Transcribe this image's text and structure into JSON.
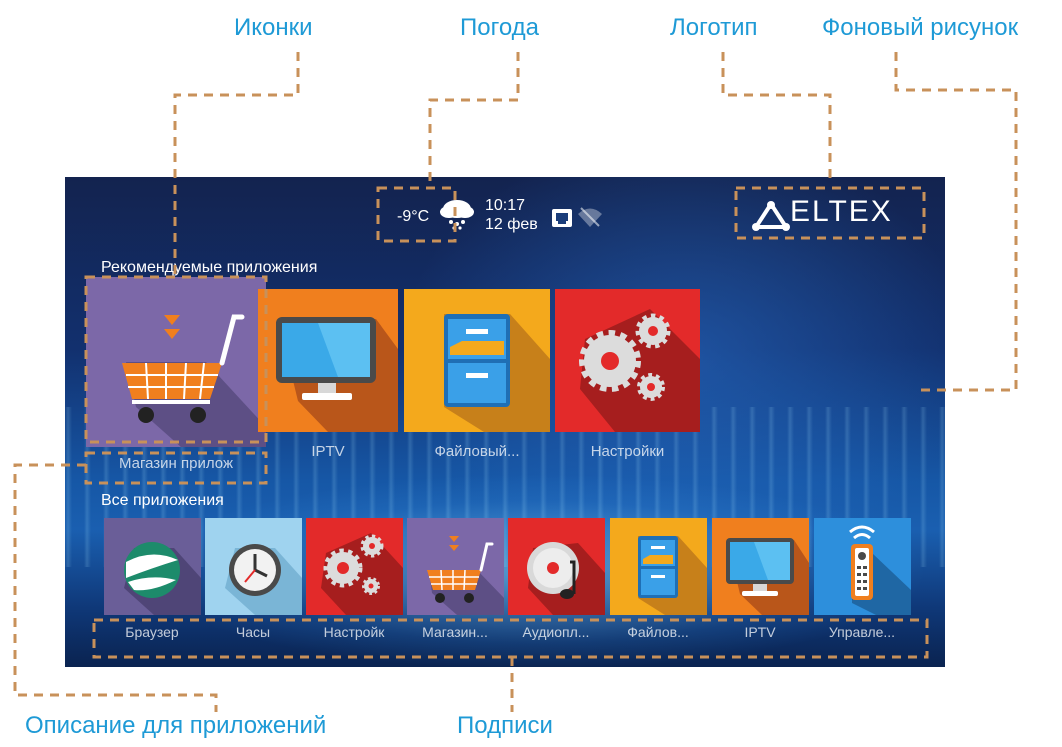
{
  "callouts": {
    "icons": "Иконки",
    "weather": "Погода",
    "logo": "Логотип",
    "background": "Фоновый рисунок",
    "app_description": "Описание для приложений",
    "captions": "Подписи"
  },
  "status_bar": {
    "temperature": "-9°C",
    "weather_icon": "snow-cloud-icon",
    "time": "10:17",
    "date": "12 фев",
    "network_icon": "ethernet-icon",
    "wifi_icon": "wifi-off-icon"
  },
  "logo": {
    "text": "ELTEX"
  },
  "recommended": {
    "title": "Рекомендуемые приложения",
    "items": [
      {
        "label": "Магазин прилож",
        "icon": "shopping-cart-icon",
        "color": "#7c68a8"
      },
      {
        "label": "IPTV",
        "icon": "monitor-icon",
        "color": "#f07f1e"
      },
      {
        "label": "Файловый...",
        "icon": "file-cabinet-icon",
        "color": "#f4a91c"
      },
      {
        "label": "Настройки",
        "icon": "gears-icon",
        "color": "#e32a2a"
      }
    ]
  },
  "all_apps": {
    "title": "Все приложения",
    "items": [
      {
        "label": "Браузер",
        "icon": "globe-icon",
        "color": "#6a5e98"
      },
      {
        "label": "Часы",
        "icon": "clock-icon",
        "color": "#9fd3ef"
      },
      {
        "label": "Настройк",
        "icon": "gears-icon",
        "color": "#e32a2a"
      },
      {
        "label": "Магазин...",
        "icon": "shopping-cart-icon",
        "color": "#7c68a8"
      },
      {
        "label": "Аудиопл...",
        "icon": "audio-disc-icon",
        "color": "#e32a2a"
      },
      {
        "label": "Файлов...",
        "icon": "file-cabinet-icon",
        "color": "#f4a91c"
      },
      {
        "label": "IPTV",
        "icon": "monitor-icon",
        "color": "#f07f1e"
      },
      {
        "label": "Управле...",
        "icon": "remote-control-icon",
        "color": "#2d8fdc"
      }
    ]
  },
  "accent_colors": {
    "callout_text": "#1e9ad6",
    "callout_line": "#c8915a"
  }
}
